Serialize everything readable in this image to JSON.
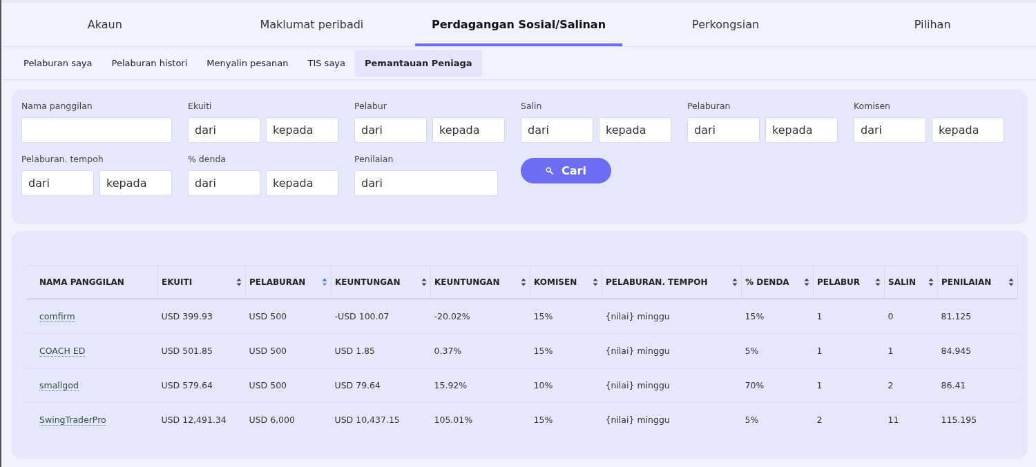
{
  "tabs": [
    {
      "label": "Akaun",
      "selected": false
    },
    {
      "label": "Maklumat peribadi",
      "selected": false
    },
    {
      "label": "Perdagangan Sosial/Salinan",
      "selected": true
    },
    {
      "label": "Perkongsian",
      "selected": false
    },
    {
      "label": "Pilihan",
      "selected": false
    }
  ],
  "subtabs": [
    {
      "label": "Pelaburan saya",
      "selected": false
    },
    {
      "label": "Pelaburan histori",
      "selected": false
    },
    {
      "label": "Menyalin pesanan",
      "selected": false
    },
    {
      "label": "TIS saya",
      "selected": false
    },
    {
      "label": "Pemantauan Peniaga",
      "selected": true
    }
  ],
  "filters": [
    {
      "label": "Nama panggilan",
      "kind": "text"
    },
    {
      "label": "Ekuiti",
      "kind": "range",
      "inputs": [
        {
          "placeholder": "dari"
        },
        {
          "placeholder": "kepada"
        }
      ]
    },
    {
      "label": "Pelabur",
      "kind": "range",
      "inputs": [
        {
          "placeholder": "dari"
        },
        {
          "placeholder": "kepada"
        }
      ]
    },
    {
      "label": "Salin",
      "kind": "range",
      "inputs": [
        {
          "placeholder": "dari"
        },
        {
          "placeholder": "kepada"
        }
      ]
    },
    {
      "label": "Pelaburan",
      "kind": "range",
      "inputs": [
        {
          "placeholder": "dari"
        },
        {
          "placeholder": "kepada"
        }
      ]
    },
    {
      "label": "Komisen",
      "kind": "range",
      "inputs": [
        {
          "placeholder": "dari"
        },
        {
          "placeholder": "kepada"
        }
      ]
    },
    {
      "label": "Pelaburan. tempoh",
      "kind": "range",
      "inputs": [
        {
          "placeholder": "dari"
        },
        {
          "placeholder": "kepada"
        }
      ]
    },
    {
      "label": "% denda",
      "kind": "range",
      "inputs": [
        {
          "placeholder": "dari"
        },
        {
          "placeholder": "kepada"
        }
      ]
    },
    {
      "label": "Penilaian",
      "kind": "single",
      "inputs": [
        {
          "placeholder": "dari"
        }
      ]
    }
  ],
  "search_button": "Cari",
  "table": {
    "columns": [
      {
        "label": "NAMA PANGGILAN",
        "sortable": false
      },
      {
        "label": "EKUITI",
        "sortable": true,
        "sorted": false
      },
      {
        "label": "PELABURAN",
        "sortable": true,
        "sorted": true
      },
      {
        "label": "KEUNTUNGAN",
        "sortable": true,
        "sorted": false
      },
      {
        "label": "KEUNTUNGAN",
        "sortable": true,
        "sorted": false
      },
      {
        "label": "KOMISEN",
        "sortable": true,
        "sorted": false
      },
      {
        "label": "PELABURAN. TEMPOH",
        "sortable": true,
        "sorted": false
      },
      {
        "label": "% DENDA",
        "sortable": true,
        "sorted": false
      },
      {
        "label": "PELABUR",
        "sortable": true,
        "sorted": false
      },
      {
        "label": "SALIN",
        "sortable": true,
        "sorted": false
      },
      {
        "label": "PENILAIAN",
        "sortable": true,
        "sorted": false
      }
    ],
    "rows": [
      [
        "comfirm",
        "USD 399.93",
        "USD 500",
        "-USD 100.07",
        "-20.02%",
        "15%",
        "{nilai} minggu",
        "15%",
        "1",
        "0",
        "81.125"
      ],
      [
        "COACH ED",
        "USD 501.85",
        "USD 500",
        "USD 1.85",
        "0.37%",
        "15%",
        "{nilai} minggu",
        "5%",
        "1",
        "1",
        "84.945"
      ],
      [
        "smallgod",
        "USD 579.64",
        "USD 500",
        "USD 79.64",
        "15.92%",
        "10%",
        "{nilai} minggu",
        "70%",
        "1",
        "2",
        "86.41"
      ],
      [
        "SwingTraderPro",
        "USD 12,491.34",
        "USD 6,000",
        "USD 10,437.15",
        "105.01%",
        "15%",
        "{nilai} minggu",
        "5%",
        "2",
        "11",
        "115.195"
      ]
    ]
  }
}
